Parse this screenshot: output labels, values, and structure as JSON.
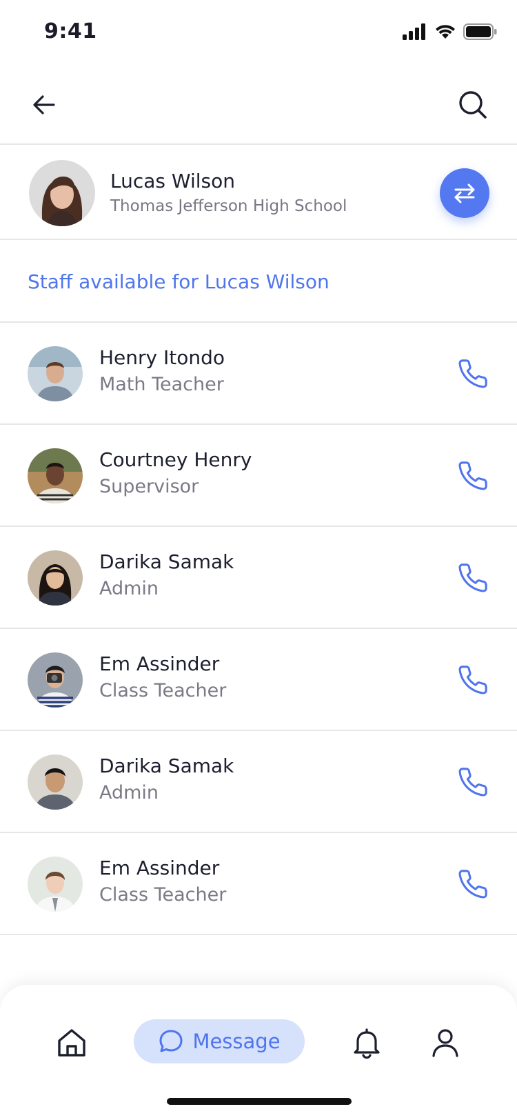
{
  "status_bar": {
    "time": "9:41"
  },
  "header": {
    "back_icon": "arrow-left-icon",
    "search_icon": "search-icon"
  },
  "student": {
    "name": "Lucas Wilson",
    "school": "Thomas Jefferson High School",
    "switch_icon": "swap-icon"
  },
  "section": {
    "title": "Staff available for Lucas Wilson"
  },
  "staff": [
    {
      "name": "Henry Itondo",
      "role": "Math Teacher"
    },
    {
      "name": "Courtney Henry",
      "role": "Supervisor"
    },
    {
      "name": "Darika Samak",
      "role": "Admin"
    },
    {
      "name": "Em Assinder",
      "role": "Class Teacher"
    },
    {
      "name": "Darika Samak",
      "role": "Admin"
    },
    {
      "name": "Em Assinder",
      "role": "Class Teacher"
    }
  ],
  "bottom_nav": {
    "items": [
      {
        "icon": "home-icon"
      },
      {
        "icon": "chat-icon",
        "label": "Message",
        "active": true
      },
      {
        "icon": "bell-icon"
      },
      {
        "icon": "user-icon"
      }
    ]
  },
  "colors": {
    "accent": "#4f75ee",
    "accent_bg": "#d6e2fb",
    "text": "#1d1f2e",
    "muted": "#7a7a86"
  }
}
